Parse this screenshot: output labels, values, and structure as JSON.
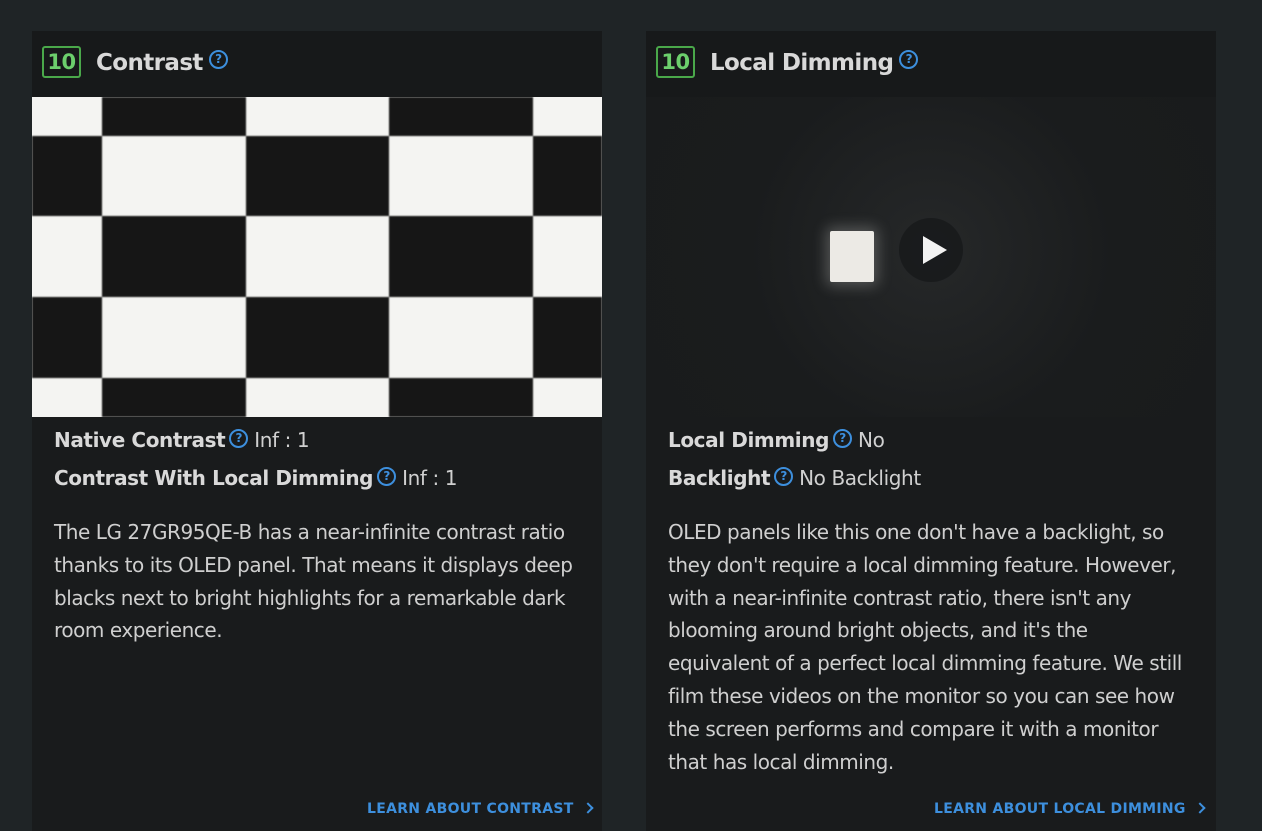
{
  "sections": [
    {
      "score": "10",
      "title": "Contrast",
      "specs": [
        {
          "label": "Native Contrast",
          "value": "Inf : 1"
        },
        {
          "label": "Contrast With Local Dimming",
          "value": "Inf : 1"
        }
      ],
      "description": "The LG 27GR95QE-B has a near-infinite contrast ratio thanks to its OLED panel. That means it displays deep blacks next to bright highlights for a remarkable dark room experience.",
      "learn_link": "LEARN ABOUT CONTRAST"
    },
    {
      "score": "10",
      "title": "Local Dimming",
      "specs": [
        {
          "label": "Local Dimming",
          "value": "No"
        },
        {
          "label": "Backlight",
          "value": "No Backlight"
        }
      ],
      "description": "OLED panels like this one don't have a backlight, so they don't require a local dimming feature. However, with a near-infinite contrast ratio, there isn't any blooming around bright objects, and it's the equivalent of a perfect local dimming feature. We still film these videos on the monitor so you can see how the screen performs and compare it with a monitor that has local dimming.",
      "learn_link": "LEARN ABOUT LOCAL DIMMING"
    }
  ],
  "icons": {
    "help": "question-circle-icon",
    "play": "play-icon",
    "chevron": "chevron-right-icon"
  },
  "colors": {
    "score_border": "#4aa84a",
    "score_text": "#6ccf6c",
    "link": "#3d8fdd",
    "help_icon": "#3d8fdd",
    "background": "#1f2426",
    "card": "#191b1c"
  }
}
